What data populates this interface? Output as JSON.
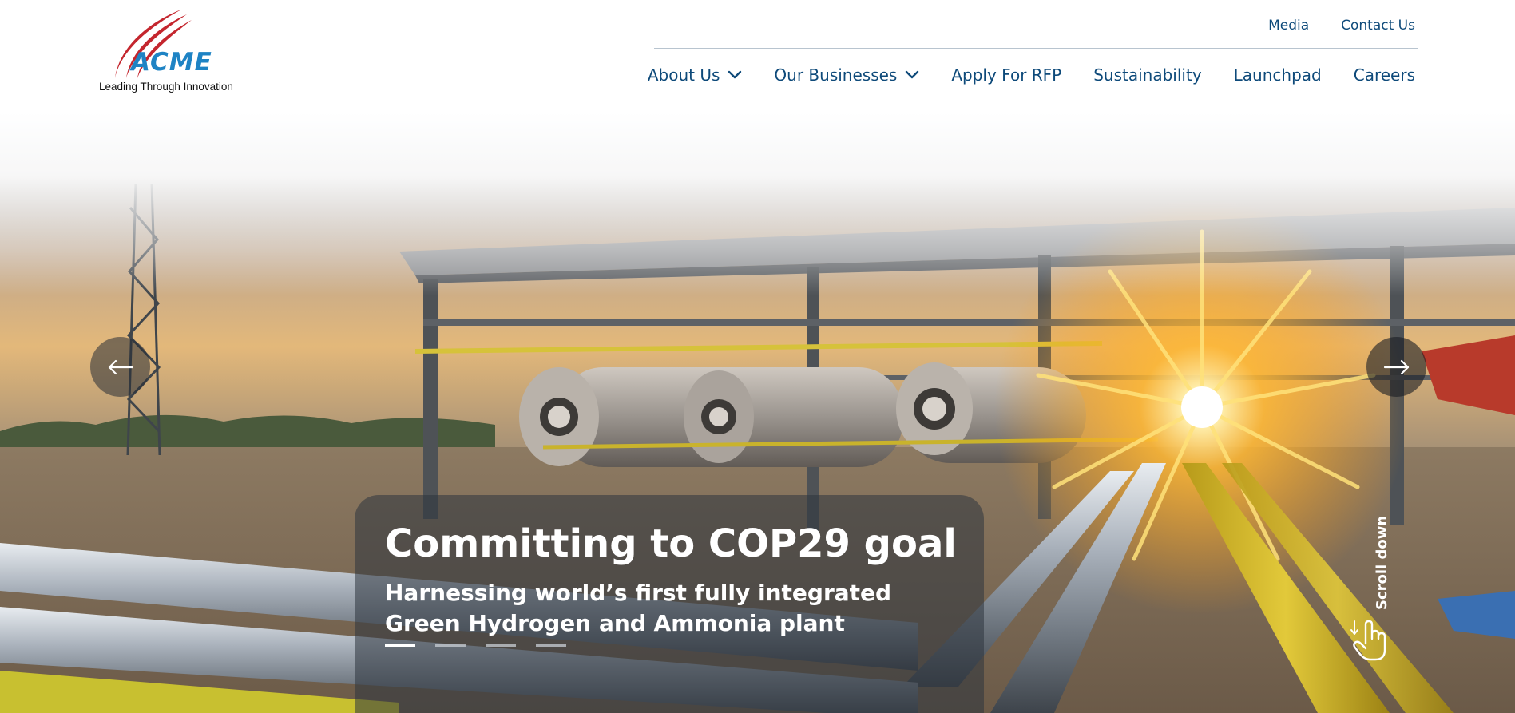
{
  "brand": {
    "wordmark": "ACME",
    "tagline": "Leading Through Innovation",
    "wordmark_color": "#1e83c4",
    "mark_color": "#c4262e"
  },
  "utility_nav": {
    "media": "Media",
    "contact": "Contact Us"
  },
  "main_nav": {
    "about": "About Us",
    "businesses": "Our Businesses",
    "rfp": "Apply For RFP",
    "sustainability": "Sustainability",
    "launchpad": "Launchpad",
    "careers": "Careers"
  },
  "hero": {
    "title": "Committing to COP29 goal",
    "subtitle": "Harnessing world’s first fully integrated Green Hydrogen and Ammonia plant",
    "slides_total": 4,
    "active_slide": 1,
    "scroll_label": "Scroll down"
  },
  "colors": {
    "nav_text": "#0e4a7a",
    "accent_blue": "#1e83c4",
    "accent_red": "#c4262e"
  },
  "icons": {
    "prev": "arrow-left-icon",
    "next": "arrow-right-icon",
    "dropdown": "chevron-down-icon",
    "scroll": "hand-pointer-icon"
  }
}
